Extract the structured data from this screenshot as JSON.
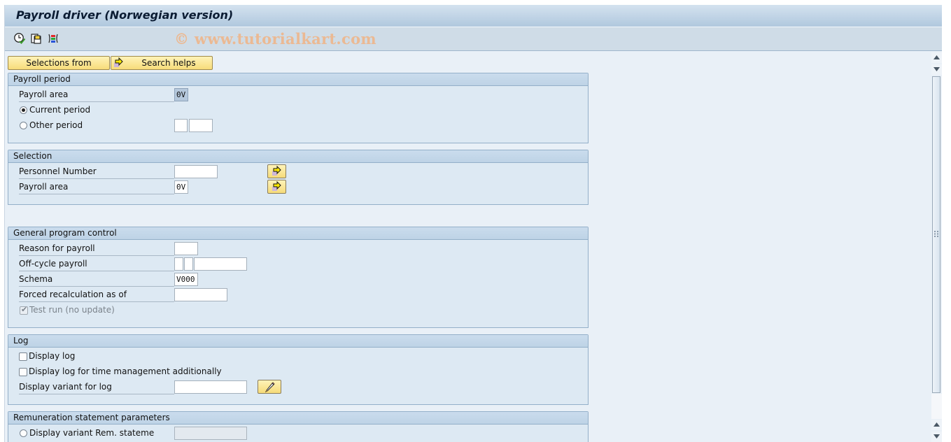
{
  "window": {
    "title": "Payroll driver (Norwegian version)",
    "watermark": "© www.tutorialkart.com"
  },
  "toolbar": {
    "icons": [
      "execute-in-background-icon",
      "get-variant-icon",
      "selection-options-icon"
    ]
  },
  "buttons": {
    "selections_from": "Selections from",
    "search_helps": "Search helps"
  },
  "payroll_period": {
    "title": "Payroll period",
    "payroll_area_label": "Payroll area",
    "payroll_area_value": "0V",
    "current_period_label": "Current period",
    "current_period_selected": true,
    "other_period_label": "Other period",
    "other_period_selected": false,
    "other_period_value1": "",
    "other_period_value2": ""
  },
  "selection": {
    "title": "Selection",
    "personnel_number_label": "Personnel Number",
    "personnel_number_value": "",
    "payroll_area_label": "Payroll area",
    "payroll_area_value": "0V"
  },
  "general": {
    "title": "General program control",
    "reason_label": "Reason for payroll",
    "reason_value": "",
    "offcycle_label": "Off-cycle payroll",
    "offcycle_value1": "",
    "offcycle_value2": "",
    "offcycle_value3": "",
    "schema_label": "Schema",
    "schema_value": "V000",
    "forced_label": "Forced recalculation as of",
    "forced_value": "",
    "test_run_label": "Test run (no update)",
    "test_run_checked": true,
    "test_run_disabled": true
  },
  "log": {
    "title": "Log",
    "display_log_label": "Display log",
    "display_log_checked": false,
    "display_log_time_label": "Display log for time management additionally",
    "display_log_time_checked": false,
    "variant_label": "Display variant for log",
    "variant_value": ""
  },
  "remuneration": {
    "title": "Remuneration statement parameters",
    "variant_label": "Display variant Rem. stateme",
    "variant_value": ""
  },
  "colors": {
    "button_yellow": "#f7dc7a",
    "group_header": "#c4d7e9",
    "background": "#e9f0f7"
  }
}
